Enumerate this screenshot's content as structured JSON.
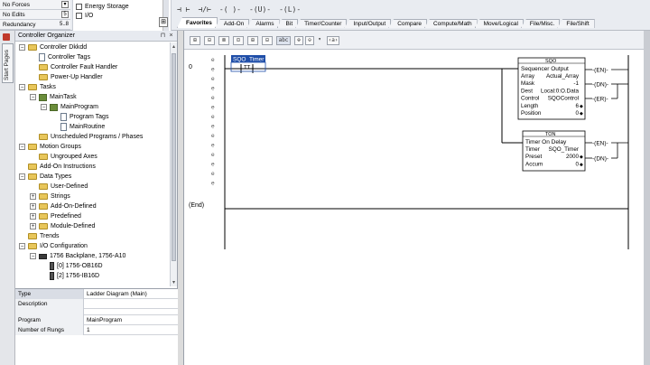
{
  "status": {
    "forces": "No Forces",
    "edits": "No Edits",
    "redundancy": "Redundancy",
    "edits_mark": "5",
    "redundancy_mark": "5..8"
  },
  "energy_panel": {
    "item1": "Energy Storage",
    "item2": "I/O",
    "button": "⊞"
  },
  "instruction_symbols": [
    "⊣ ⊢",
    "⊣/⊢",
    "-( )-",
    "-(U)-",
    "-(L)-"
  ],
  "tabs": [
    "Favorites",
    "Add-On",
    "Alarms",
    "Bit",
    "Timer/Counter",
    "Input/Output",
    "Compare",
    "Compute/Math",
    "Move/Logical",
    "File/Misc.",
    "File/Shift"
  ],
  "start_pages": "Start Pages",
  "organizer": {
    "title": "Controller Organizer",
    "pin": "⊓",
    "close": "×",
    "tree": [
      {
        "label": "Controller Dkkdd",
        "depth": 0,
        "exp": "−",
        "icon": "folder-icon"
      },
      {
        "label": "Controller Tags",
        "depth": 1,
        "exp": "",
        "icon": "doc-icon"
      },
      {
        "label": "Controller Fault Handler",
        "depth": 1,
        "exp": "",
        "icon": "folder-icon"
      },
      {
        "label": "Power-Up Handler",
        "depth": 1,
        "exp": "",
        "icon": "folder-icon"
      },
      {
        "label": "Tasks",
        "depth": 0,
        "exp": "−",
        "icon": "folder-icon"
      },
      {
        "label": "MainTask",
        "depth": 1,
        "exp": "−",
        "icon": "task-icon"
      },
      {
        "label": "MainProgram",
        "depth": 2,
        "exp": "−",
        "icon": "task-icon"
      },
      {
        "label": "Program Tags",
        "depth": 3,
        "exp": "",
        "icon": "doc-icon"
      },
      {
        "label": "MainRoutine",
        "depth": 3,
        "exp": "",
        "icon": "doc-icon"
      },
      {
        "label": "Unscheduled Programs / Phases",
        "depth": 1,
        "exp": "",
        "icon": "folder-icon"
      },
      {
        "label": "Motion Groups",
        "depth": 0,
        "exp": "−",
        "icon": "folder-icon"
      },
      {
        "label": "Ungrouped Axes",
        "depth": 1,
        "exp": "",
        "icon": "folder-icon"
      },
      {
        "label": "Add-On Instructions",
        "depth": 0,
        "exp": "",
        "icon": "folder-icon"
      },
      {
        "label": "Data Types",
        "depth": 0,
        "exp": "−",
        "icon": "folder-icon"
      },
      {
        "label": "User-Defined",
        "depth": 1,
        "exp": "",
        "icon": "folder-icon"
      },
      {
        "label": "Strings",
        "depth": 1,
        "exp": "+",
        "icon": "folder-icon"
      },
      {
        "label": "Add-On-Defined",
        "depth": 1,
        "exp": "+",
        "icon": "folder-icon"
      },
      {
        "label": "Predefined",
        "depth": 1,
        "exp": "+",
        "icon": "folder-icon"
      },
      {
        "label": "Module-Defined",
        "depth": 1,
        "exp": "+",
        "icon": "folder-icon"
      },
      {
        "label": "Trends",
        "depth": 0,
        "exp": "",
        "icon": "folder-icon"
      },
      {
        "label": "I/O Configuration",
        "depth": 0,
        "exp": "−",
        "icon": "folder-icon"
      },
      {
        "label": "1756 Backplane, 1756-A10",
        "depth": 1,
        "exp": "−",
        "icon": "chip-icon"
      },
      {
        "label": "[0] 1756-OB16D",
        "depth": 2,
        "exp": "",
        "icon": "module-icon"
      },
      {
        "label": "[2] 1756-IB16D",
        "depth": 2,
        "exp": "",
        "icon": "module-icon"
      }
    ],
    "properties": [
      {
        "key": "Type",
        "value": "Ladder Diagram (Main)"
      },
      {
        "key": "Description",
        "value": ""
      },
      {
        "key": "Program",
        "value": "MainProgram"
      },
      {
        "key": "Number of Rungs",
        "value": "1"
      }
    ]
  },
  "editor_toolbar": [
    "⊞",
    "⊟",
    "⊠",
    "⊡",
    "⊞",
    "⊟",
    "abc",
    "⊕",
    "⊖",
    "▾",
    "‹a›"
  ],
  "ladder": {
    "rung_number": "0",
    "end_label": "(End)",
    "rail_markers": [
      "e",
      "e",
      "e",
      "e",
      "e",
      "e",
      "e",
      "e",
      "e",
      "e",
      "e",
      "e",
      "e",
      "e"
    ],
    "contact_tag": "SQO_Timer",
    "contact_sub": "TT",
    "sqo": {
      "name": "SQO",
      "title": "Sequencer Output",
      "rows": [
        {
          "key": "Array",
          "value": "Actual_Array",
          "arrow": ""
        },
        {
          "key": "Mask",
          "value": "-1",
          "arrow": ""
        },
        {
          "key": "Dest",
          "value": "Local:0:O.Data",
          "arrow": ""
        },
        {
          "key": "Control",
          "value": "SQOControl",
          "arrow": ""
        },
        {
          "key": "Length",
          "value": "6",
          "arrow": "◆"
        },
        {
          "key": "Position",
          "value": "0",
          "arrow": "◆"
        }
      ],
      "out1": "EN",
      "out2": "DN",
      "out3": "ER"
    },
    "ton": {
      "name": "TON",
      "title": "Timer On Delay",
      "rows": [
        {
          "key": "Timer",
          "value": "SQO_Timer",
          "arrow": ""
        },
        {
          "key": "Preset",
          "value": "2000",
          "arrow": "◆"
        },
        {
          "key": "Accum",
          "value": "0",
          "arrow": "◆"
        }
      ],
      "out1": "EN",
      "out2": "DN"
    }
  }
}
